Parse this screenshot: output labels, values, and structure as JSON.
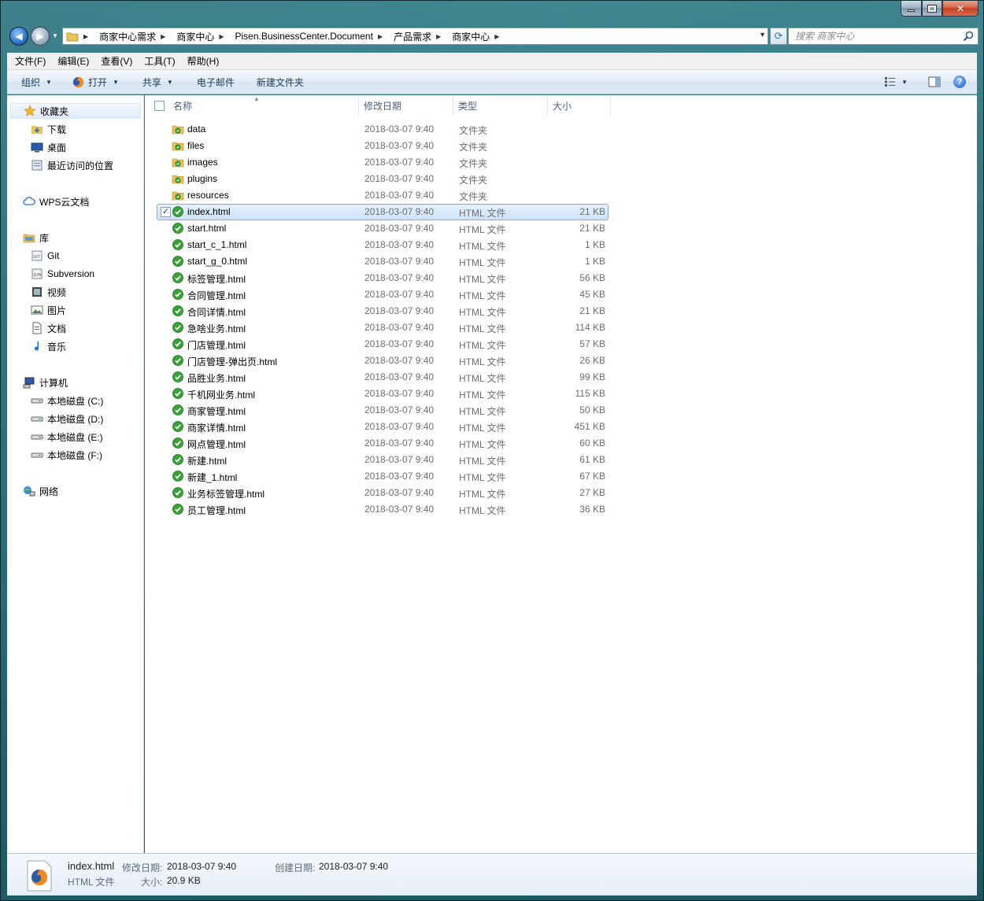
{
  "address": {
    "crumbs": [
      "商家中心需求",
      "商家中心",
      "Pisen.BusinessCenter.Document",
      "产品需求",
      "商家中心"
    ]
  },
  "search": {
    "placeholder": "搜索 商家中心"
  },
  "menu": [
    "文件(F)",
    "编辑(E)",
    "查看(V)",
    "工具(T)",
    "帮助(H)"
  ],
  "toolbar": {
    "organize": "组织",
    "open": "打开",
    "share": "共享",
    "email": "电子邮件",
    "new_folder": "新建文件夹"
  },
  "nav": {
    "favorites": "收藏夹",
    "fav_items": [
      "下载",
      "桌面",
      "最近访问的位置"
    ],
    "wps": "WPS云文档",
    "library": "库",
    "lib_items": [
      "Git",
      "Subversion",
      "视频",
      "图片",
      "文档",
      "音乐"
    ],
    "computer": "计算机",
    "drives": [
      "本地磁盘 (C:)",
      "本地磁盘 (D:)",
      "本地磁盘 (E:)",
      "本地磁盘 (F:)"
    ],
    "network": "网络"
  },
  "columns": {
    "name": "名称",
    "date": "修改日期",
    "type": "类型",
    "size": "大小"
  },
  "files": [
    {
      "name": "data",
      "date": "2018-03-07 9:40",
      "type": "文件夹",
      "size": "",
      "kind": "folder"
    },
    {
      "name": "files",
      "date": "2018-03-07 9:40",
      "type": "文件夹",
      "size": "",
      "kind": "folder"
    },
    {
      "name": "images",
      "date": "2018-03-07 9:40",
      "type": "文件夹",
      "size": "",
      "kind": "folder"
    },
    {
      "name": "plugins",
      "date": "2018-03-07 9:40",
      "type": "文件夹",
      "size": "",
      "kind": "folder"
    },
    {
      "name": "resources",
      "date": "2018-03-07 9:40",
      "type": "文件夹",
      "size": "",
      "kind": "folder"
    },
    {
      "name": "index.html",
      "date": "2018-03-07 9:40",
      "type": "HTML 文件",
      "size": "21 KB",
      "kind": "html",
      "selected": true
    },
    {
      "name": "start.html",
      "date": "2018-03-07 9:40",
      "type": "HTML 文件",
      "size": "21 KB",
      "kind": "html"
    },
    {
      "name": "start_c_1.html",
      "date": "2018-03-07 9:40",
      "type": "HTML 文件",
      "size": "1 KB",
      "kind": "html"
    },
    {
      "name": "start_g_0.html",
      "date": "2018-03-07 9:40",
      "type": "HTML 文件",
      "size": "1 KB",
      "kind": "html"
    },
    {
      "name": "标签管理.html",
      "date": "2018-03-07 9:40",
      "type": "HTML 文件",
      "size": "56 KB",
      "kind": "html"
    },
    {
      "name": "合同管理.html",
      "date": "2018-03-07 9:40",
      "type": "HTML 文件",
      "size": "45 KB",
      "kind": "html"
    },
    {
      "name": "合同详情.html",
      "date": "2018-03-07 9:40",
      "type": "HTML 文件",
      "size": "21 KB",
      "kind": "html"
    },
    {
      "name": "急啥业务.html",
      "date": "2018-03-07 9:40",
      "type": "HTML 文件",
      "size": "114 KB",
      "kind": "html"
    },
    {
      "name": "门店管理.html",
      "date": "2018-03-07 9:40",
      "type": "HTML 文件",
      "size": "57 KB",
      "kind": "html"
    },
    {
      "name": "门店管理-弹出页.html",
      "date": "2018-03-07 9:40",
      "type": "HTML 文件",
      "size": "26 KB",
      "kind": "html"
    },
    {
      "name": "品胜业务.html",
      "date": "2018-03-07 9:40",
      "type": "HTML 文件",
      "size": "99 KB",
      "kind": "html"
    },
    {
      "name": "千机网业务.html",
      "date": "2018-03-07 9:40",
      "type": "HTML 文件",
      "size": "115 KB",
      "kind": "html"
    },
    {
      "name": "商家管理.html",
      "date": "2018-03-07 9:40",
      "type": "HTML 文件",
      "size": "50 KB",
      "kind": "html"
    },
    {
      "name": "商家详情.html",
      "date": "2018-03-07 9:40",
      "type": "HTML 文件",
      "size": "451 KB",
      "kind": "html"
    },
    {
      "name": "网点管理.html",
      "date": "2018-03-07 9:40",
      "type": "HTML 文件",
      "size": "60 KB",
      "kind": "html"
    },
    {
      "name": "新建.html",
      "date": "2018-03-07 9:40",
      "type": "HTML 文件",
      "size": "61 KB",
      "kind": "html"
    },
    {
      "name": "新建_1.html",
      "date": "2018-03-07 9:40",
      "type": "HTML 文件",
      "size": "67 KB",
      "kind": "html"
    },
    {
      "name": "业务标签管理.html",
      "date": "2018-03-07 9:40",
      "type": "HTML 文件",
      "size": "27 KB",
      "kind": "html"
    },
    {
      "name": "员工管理.html",
      "date": "2018-03-07 9:40",
      "type": "HTML 文件",
      "size": "36 KB",
      "kind": "html"
    }
  ],
  "details": {
    "filename": "index.html",
    "filetype": "HTML 文件",
    "modified_label": "修改日期:",
    "modified_value": "2018-03-07 9:40",
    "created_label": "创建日期:",
    "created_value": "2018-03-07 9:40",
    "size_label": "大小:",
    "size_value": "20.9 KB"
  }
}
